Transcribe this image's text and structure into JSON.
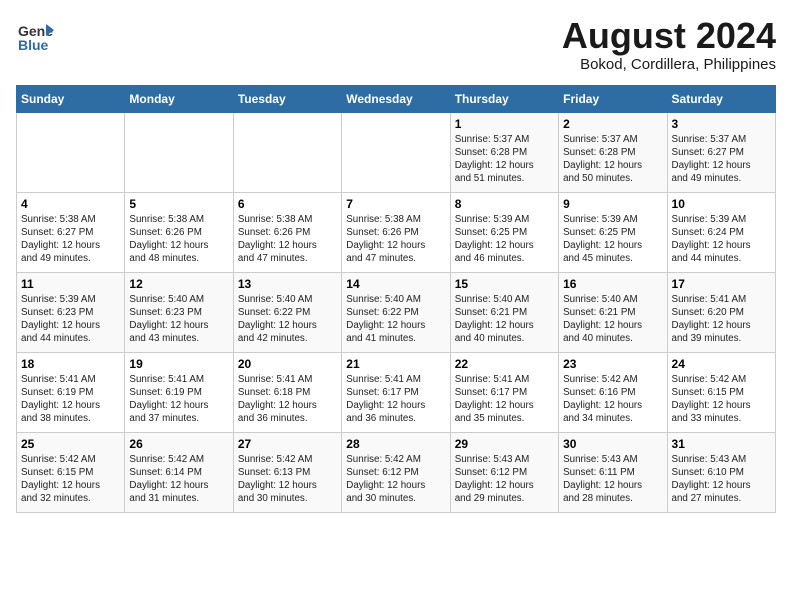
{
  "header": {
    "logo_line1": "General",
    "logo_line2": "Blue",
    "title": "August 2024",
    "subtitle": "Bokod, Cordillera, Philippines"
  },
  "days_of_week": [
    "Sunday",
    "Monday",
    "Tuesday",
    "Wednesday",
    "Thursday",
    "Friday",
    "Saturday"
  ],
  "weeks": [
    [
      {
        "day": "",
        "text": ""
      },
      {
        "day": "",
        "text": ""
      },
      {
        "day": "",
        "text": ""
      },
      {
        "day": "",
        "text": ""
      },
      {
        "day": "1",
        "text": "Sunrise: 5:37 AM\nSunset: 6:28 PM\nDaylight: 12 hours\nand 51 minutes."
      },
      {
        "day": "2",
        "text": "Sunrise: 5:37 AM\nSunset: 6:28 PM\nDaylight: 12 hours\nand 50 minutes."
      },
      {
        "day": "3",
        "text": "Sunrise: 5:37 AM\nSunset: 6:27 PM\nDaylight: 12 hours\nand 49 minutes."
      }
    ],
    [
      {
        "day": "4",
        "text": "Sunrise: 5:38 AM\nSunset: 6:27 PM\nDaylight: 12 hours\nand 49 minutes."
      },
      {
        "day": "5",
        "text": "Sunrise: 5:38 AM\nSunset: 6:26 PM\nDaylight: 12 hours\nand 48 minutes."
      },
      {
        "day": "6",
        "text": "Sunrise: 5:38 AM\nSunset: 6:26 PM\nDaylight: 12 hours\nand 47 minutes."
      },
      {
        "day": "7",
        "text": "Sunrise: 5:38 AM\nSunset: 6:26 PM\nDaylight: 12 hours\nand 47 minutes."
      },
      {
        "day": "8",
        "text": "Sunrise: 5:39 AM\nSunset: 6:25 PM\nDaylight: 12 hours\nand 46 minutes."
      },
      {
        "day": "9",
        "text": "Sunrise: 5:39 AM\nSunset: 6:25 PM\nDaylight: 12 hours\nand 45 minutes."
      },
      {
        "day": "10",
        "text": "Sunrise: 5:39 AM\nSunset: 6:24 PM\nDaylight: 12 hours\nand 44 minutes."
      }
    ],
    [
      {
        "day": "11",
        "text": "Sunrise: 5:39 AM\nSunset: 6:23 PM\nDaylight: 12 hours\nand 44 minutes."
      },
      {
        "day": "12",
        "text": "Sunrise: 5:40 AM\nSunset: 6:23 PM\nDaylight: 12 hours\nand 43 minutes."
      },
      {
        "day": "13",
        "text": "Sunrise: 5:40 AM\nSunset: 6:22 PM\nDaylight: 12 hours\nand 42 minutes."
      },
      {
        "day": "14",
        "text": "Sunrise: 5:40 AM\nSunset: 6:22 PM\nDaylight: 12 hours\nand 41 minutes."
      },
      {
        "day": "15",
        "text": "Sunrise: 5:40 AM\nSunset: 6:21 PM\nDaylight: 12 hours\nand 40 minutes."
      },
      {
        "day": "16",
        "text": "Sunrise: 5:40 AM\nSunset: 6:21 PM\nDaylight: 12 hours\nand 40 minutes."
      },
      {
        "day": "17",
        "text": "Sunrise: 5:41 AM\nSunset: 6:20 PM\nDaylight: 12 hours\nand 39 minutes."
      }
    ],
    [
      {
        "day": "18",
        "text": "Sunrise: 5:41 AM\nSunset: 6:19 PM\nDaylight: 12 hours\nand 38 minutes."
      },
      {
        "day": "19",
        "text": "Sunrise: 5:41 AM\nSunset: 6:19 PM\nDaylight: 12 hours\nand 37 minutes."
      },
      {
        "day": "20",
        "text": "Sunrise: 5:41 AM\nSunset: 6:18 PM\nDaylight: 12 hours\nand 36 minutes."
      },
      {
        "day": "21",
        "text": "Sunrise: 5:41 AM\nSunset: 6:17 PM\nDaylight: 12 hours\nand 36 minutes."
      },
      {
        "day": "22",
        "text": "Sunrise: 5:41 AM\nSunset: 6:17 PM\nDaylight: 12 hours\nand 35 minutes."
      },
      {
        "day": "23",
        "text": "Sunrise: 5:42 AM\nSunset: 6:16 PM\nDaylight: 12 hours\nand 34 minutes."
      },
      {
        "day": "24",
        "text": "Sunrise: 5:42 AM\nSunset: 6:15 PM\nDaylight: 12 hours\nand 33 minutes."
      }
    ],
    [
      {
        "day": "25",
        "text": "Sunrise: 5:42 AM\nSunset: 6:15 PM\nDaylight: 12 hours\nand 32 minutes."
      },
      {
        "day": "26",
        "text": "Sunrise: 5:42 AM\nSunset: 6:14 PM\nDaylight: 12 hours\nand 31 minutes."
      },
      {
        "day": "27",
        "text": "Sunrise: 5:42 AM\nSunset: 6:13 PM\nDaylight: 12 hours\nand 30 minutes."
      },
      {
        "day": "28",
        "text": "Sunrise: 5:42 AM\nSunset: 6:12 PM\nDaylight: 12 hours\nand 30 minutes."
      },
      {
        "day": "29",
        "text": "Sunrise: 5:43 AM\nSunset: 6:12 PM\nDaylight: 12 hours\nand 29 minutes."
      },
      {
        "day": "30",
        "text": "Sunrise: 5:43 AM\nSunset: 6:11 PM\nDaylight: 12 hours\nand 28 minutes."
      },
      {
        "day": "31",
        "text": "Sunrise: 5:43 AM\nSunset: 6:10 PM\nDaylight: 12 hours\nand 27 minutes."
      }
    ]
  ]
}
